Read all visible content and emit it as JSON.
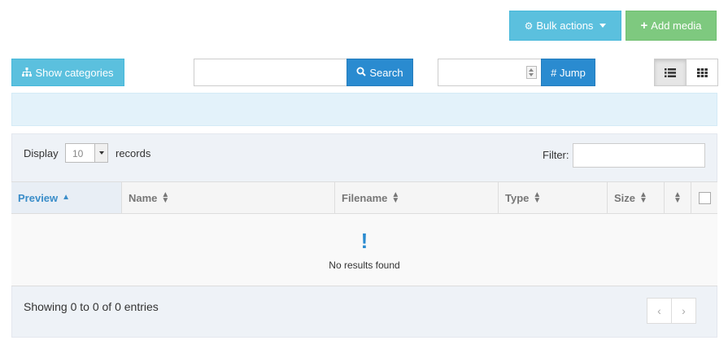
{
  "toolbar": {
    "bulk_actions_label": "Bulk actions",
    "add_media_label": "Add media",
    "show_categories_label": "Show categories",
    "search_label": "Search",
    "search_placeholder": "",
    "jump_label": "# Jump",
    "jump_value": ""
  },
  "colors": {
    "info": "#5bc0de",
    "success": "#7ec97f",
    "primary": "#2a8bd0",
    "panel": "#eef2f7"
  },
  "table_controls": {
    "display_label": "Display",
    "records_value": "10",
    "records_label": "records",
    "filter_label": "Filter:",
    "filter_value": ""
  },
  "table": {
    "columns": [
      "Preview",
      "Name",
      "Filename",
      "Type",
      "Size"
    ],
    "sorted_column": "Preview",
    "empty_icon": "!",
    "empty_message": "No results found"
  },
  "footer": {
    "showing_text": "Showing 0 to 0 of 0 entries",
    "prev_label": "‹",
    "next_label": "›"
  },
  "icons": {
    "bulk": "gear-icon",
    "add": "plus-icon",
    "categories": "sitemap-icon",
    "search": "search-icon",
    "list_view": "list-icon",
    "grid_view": "grid-icon"
  }
}
